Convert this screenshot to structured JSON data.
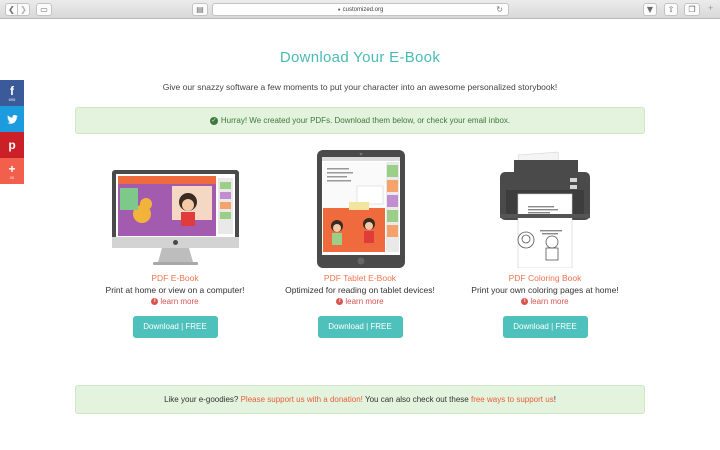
{
  "browser": {
    "url": "customized.org"
  },
  "social": {
    "facebook": {
      "icon": "f",
      "count": "695"
    },
    "twitter": {
      "icon": "t"
    },
    "pinterest": {
      "icon": "p"
    },
    "more": {
      "icon": "+",
      "count": "3K"
    }
  },
  "main": {
    "title": "Download Your E-Book",
    "subtitle": "Give our snazzy software a few moments to put your character into an awesome personalized storybook!",
    "alert": "Hurray! We created your PDFs. Download them below, or check your email inbox.",
    "products": [
      {
        "name": "PDF E-Book",
        "desc": "Print at home or view on a computer!",
        "learn": "learn more",
        "button": "Download | FREE"
      },
      {
        "name": "PDF Tablet E-Book",
        "desc": "Optimized for reading on tablet devices!",
        "learn": "learn more",
        "button": "Download | FREE"
      },
      {
        "name": "PDF Coloring Book",
        "desc": "Print your own coloring pages at home!",
        "learn": "learn more",
        "button": "Download | FREE"
      }
    ],
    "footer": {
      "part1": "Like your e-goodies? ",
      "link1": "Please support us with a donation!",
      "part2": " You can also check out these ",
      "link2": "free ways to support us",
      "part3": "!"
    }
  },
  "colors": {
    "accent": "#49bbb6",
    "button": "#4fc1bd",
    "product_name": "#f0734f",
    "alert_bg": "#e3f3dd",
    "link": "#d9534f"
  }
}
